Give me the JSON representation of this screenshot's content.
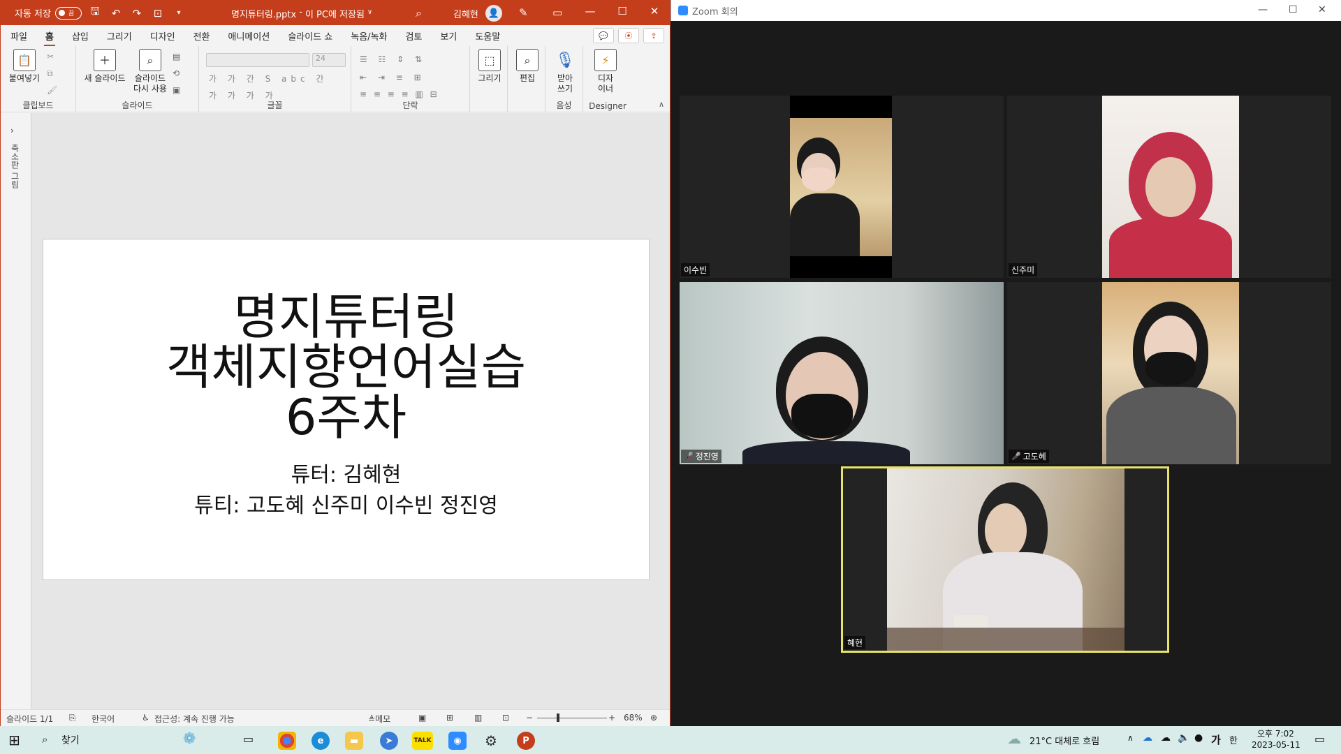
{
  "ppt": {
    "autosave_label": "자동 저장",
    "toggle_state": "끔",
    "doc_title": "명지튜터링.pptx",
    "doc_location": "이 PC에 저장됨",
    "user_name": "김혜현",
    "menu": [
      "파일",
      "홈",
      "삽입",
      "그리기",
      "디자인",
      "전환",
      "애니메이션",
      "슬라이드 쇼",
      "녹음/녹화",
      "검토",
      "보기",
      "도움말"
    ],
    "active_menu": "홈",
    "ribbon": {
      "paste": "붙여넣기",
      "clipboard_group": "클립보드",
      "new_slide": "새 슬라이드",
      "reuse_slide_1": "슬라이드",
      "reuse_slide_2": "다시 사용",
      "slides_group": "슬라이드",
      "font_size": "24",
      "font_group": "글꼴",
      "paragraph_group": "단락",
      "draw": "그리기",
      "edit": "편집",
      "dictate_1": "받아",
      "dictate_2": "쓰기",
      "voice_group": "음성",
      "designer_1": "디자",
      "designer_2": "이너",
      "designer_group": "Designer",
      "font_row1": "가 가 간 S abc 간",
      "font_row2": "가 가 가 가"
    },
    "thumb_label": "축소판 그림",
    "slide": {
      "title_line1": "명지튜터링",
      "title_line2": "객체지향언어실습",
      "title_line3": "6주차",
      "tutor": "튜터: 김혜현",
      "tutees": "튜티: 고도혜 신주미 이수빈 정진영"
    },
    "status": {
      "slide_count": "슬라이드 1/1",
      "language": "한국어",
      "accessibility": "접근성: 계속 진행 가능",
      "notes": "메모",
      "zoom": "68%"
    }
  },
  "zoom": {
    "window_title": "Zoom 회의",
    "participants": [
      {
        "name": "이수빈",
        "muted": false
      },
      {
        "name": "신주미",
        "muted": false
      },
      {
        "name": "정진영",
        "muted": true
      },
      {
        "name": "고도혜",
        "muted": true
      },
      {
        "name": "혜현",
        "muted": false
      }
    ],
    "active_speaker": "혜현"
  },
  "taskbar": {
    "search_label": "찾기",
    "weather": "21°C 대체로 흐림",
    "ime_1": "가",
    "ime_2": "한",
    "time": "오후 7:02",
    "date": "2023-05-11",
    "kakao": "TALK"
  },
  "colors": {
    "ppt_accent": "#c43e1c",
    "zoom_active": "#e8e26a",
    "taskbar": "#d9ecea"
  }
}
